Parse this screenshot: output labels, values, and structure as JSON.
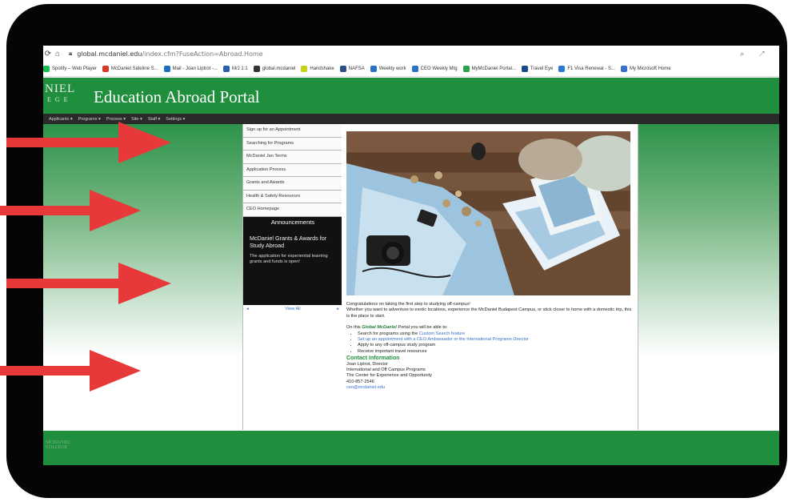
{
  "browser": {
    "url_host": "global.mcdaniel.edu",
    "url_path": "/index.cfm?FuseAction=Abroad.Home"
  },
  "bookmarks": [
    {
      "label": "Spotify – Web Player",
      "color": "#1db954"
    },
    {
      "label": "McDaniel Sideline S...",
      "color": "#d43b2a"
    },
    {
      "label": "Mail - Joan Liptrot -...",
      "color": "#1d6fbf"
    },
    {
      "label": "M/J 1:1",
      "color": "#2a5fb0"
    },
    {
      "label": "global.mcdaniel",
      "color": "#333333"
    },
    {
      "label": "Handshake",
      "color": "#c6d21b"
    },
    {
      "label": "NAFSA",
      "color": "#2b4f8a"
    },
    {
      "label": "Weekly work",
      "color": "#2a73c4"
    },
    {
      "label": "CEO Weekly Mtg",
      "color": "#2a73c4"
    },
    {
      "label": "MyMcDaniel Portal...",
      "color": "#2aa24a"
    },
    {
      "label": "Travel Eye",
      "color": "#1b4a8a"
    },
    {
      "label": "F1 Visa Renewal - S...",
      "color": "#2a7ad4"
    },
    {
      "label": "My Microsoft Home",
      "color": "#3b6fc9"
    }
  ],
  "header": {
    "logo_line1": "NIEL",
    "logo_line2": "EGE",
    "title": "Education Abroad Portal"
  },
  "menu": [
    "Applicants ▾",
    "Programs ▾",
    "Process ▾",
    "Site ▾",
    "Staff ▾",
    "Settings ▾"
  ],
  "sidebar_links": [
    "Sign up for an Appointment",
    "Searching for Programs",
    "McDaniel Jan Terms",
    "Application Process",
    "Grants and Awards",
    "Health & Safety Resources",
    "CEO Homepage"
  ],
  "announcements": {
    "heading": "Announcements",
    "title": "McDaniel Grants & Awards for Study Abroad",
    "body": "The application for experiential learning grants and funds is open!",
    "view_all": "View All"
  },
  "content": {
    "intro1": "Congratulations on taking the first step to studying off-campus!",
    "intro2": "Whether you want to adventure to exotic locations, experience the McDaniel Budapest Campus, or stick closer to home with a domestic trip, this is the place to start.",
    "portal_prefix": "On this",
    "portal_name": "Global McDaniel",
    "portal_suffix": "Portal you will be able to:",
    "item1_prefix": "Search for programs using the",
    "item1_link": "Custom Search feature",
    "item2": "Set up an  appointment with a CEO Ambassador or the International Programs Director",
    "item3": "Apply to any off-campus study program",
    "item4": "Receive important travel resources",
    "contact_heading": "Contact Information",
    "contact_name": "Joan Liptrot, Director",
    "contact_role": "International and Off Campus Programs",
    "contact_org": "The Center for Experience and Opportunity",
    "contact_phone": "410-857-2546",
    "contact_email": "ceo@mcdaniel.edu"
  },
  "colors": {
    "brand_green": "#1f8f3e",
    "arrow_red": "#e8393a",
    "link_blue": "#3a72c9"
  }
}
